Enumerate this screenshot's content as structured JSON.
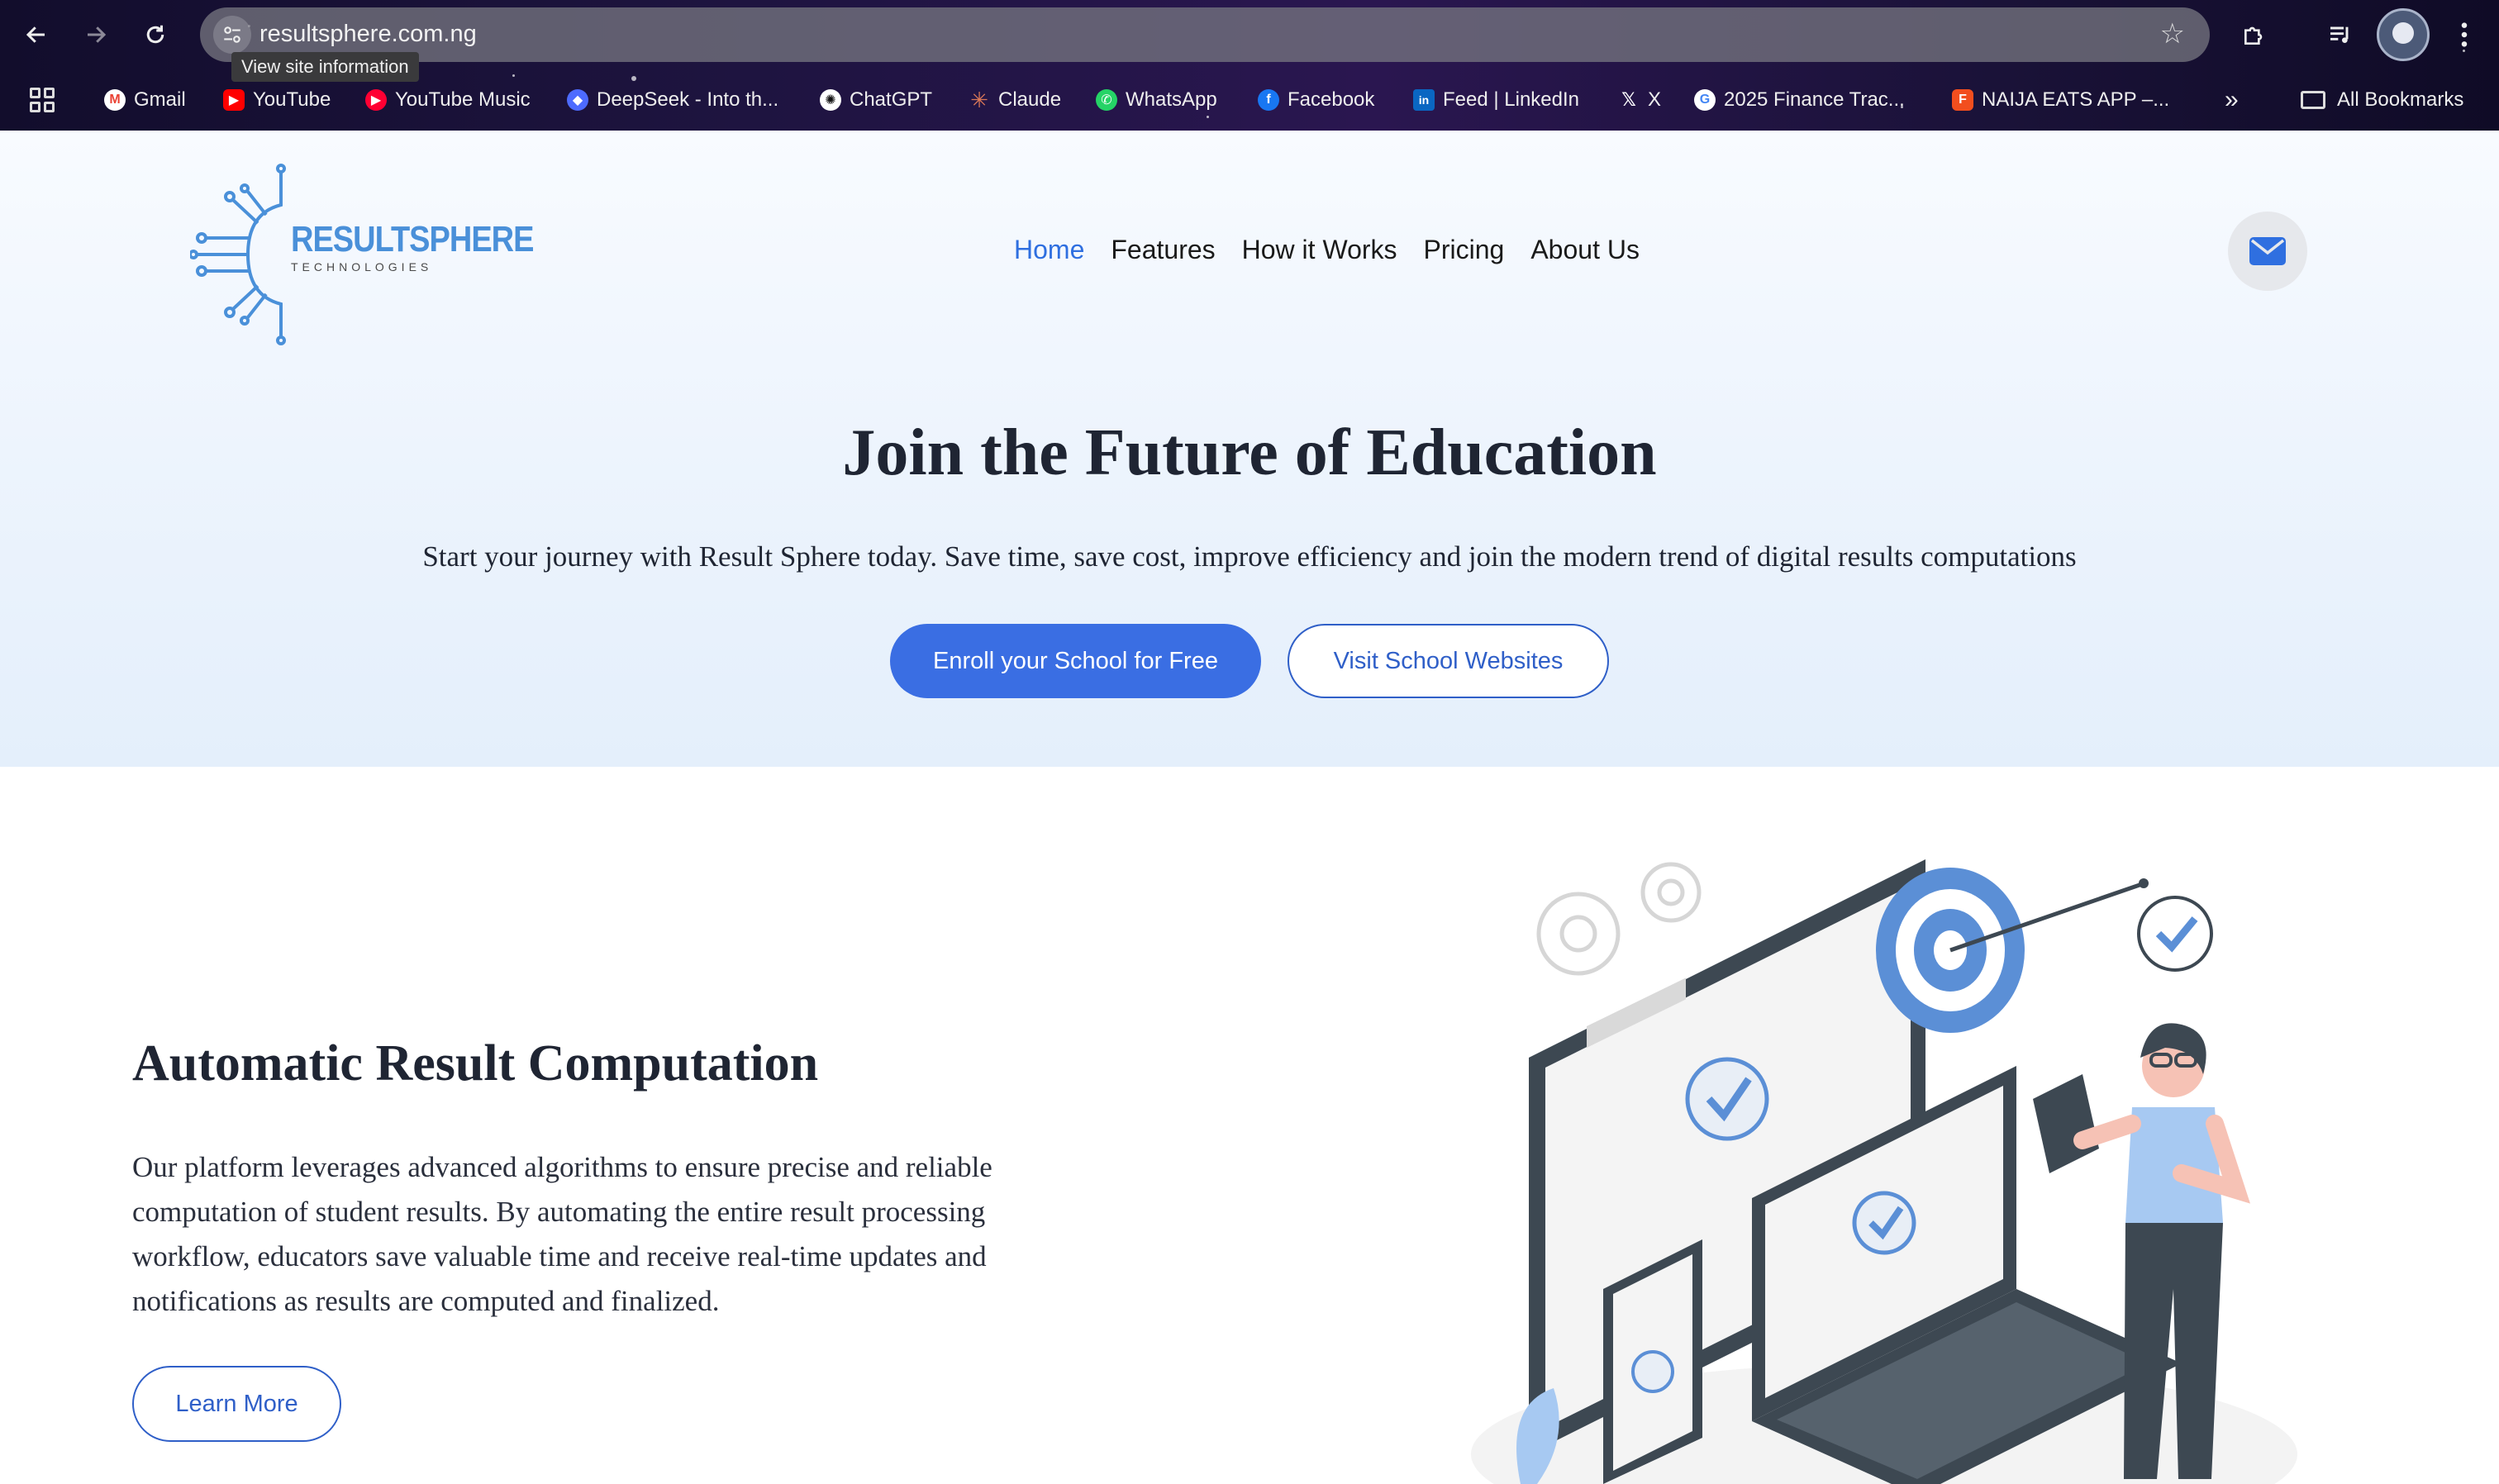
{
  "browser": {
    "url": "resultsphere.com.ng",
    "tooltip": "View site information",
    "bookmarks": [
      {
        "label": "Gmail",
        "icon": "gmail-icon",
        "color": "#ea4335"
      },
      {
        "label": "YouTube",
        "icon": "youtube-icon",
        "color": "#ff0000"
      },
      {
        "label": "YouTube Music",
        "icon": "youtube-music-icon",
        "color": "#ff0033"
      },
      {
        "label": "DeepSeek - Into th...",
        "icon": "deepseek-icon",
        "color": "#4d6bfe"
      },
      {
        "label": "ChatGPT",
        "icon": "chatgpt-icon",
        "color": "#ffffff"
      },
      {
        "label": "Claude",
        "icon": "claude-icon",
        "color": "#d97757"
      },
      {
        "label": "WhatsApp",
        "icon": "whatsapp-icon",
        "color": "#25d366"
      },
      {
        "label": "Facebook",
        "icon": "facebook-icon",
        "color": "#1877f2"
      },
      {
        "label": "Feed | LinkedIn",
        "icon": "linkedin-icon",
        "color": "#0a66c2"
      },
      {
        "label": "X",
        "icon": "x-icon",
        "color": "#ffffff"
      },
      {
        "label": "2025 Finance Trac...",
        "icon": "google-icon",
        "color": "#4285f4"
      },
      {
        "label": "NAIJA EATS APP –...",
        "icon": "figma-icon",
        "color": "#f24e1e"
      }
    ],
    "all_bookmarks": "All Bookmarks"
  },
  "site": {
    "logo_main": "RESULTSPHERE",
    "logo_sub": "TECHNOLOGIES",
    "nav": [
      "Home",
      "Features",
      "How it Works",
      "Pricing",
      "About Us"
    ],
    "active_nav": "Home",
    "accent": "#3a6ee3"
  },
  "hero": {
    "title": "Join the Future of Education",
    "subtitle": "Start your journey with Result Sphere today. Save time, save cost, improve efficiency and join the modern trend of digital results computations",
    "primary_cta": "Enroll your School for Free",
    "secondary_cta": "Visit School Websites"
  },
  "feature": {
    "title": "Automatic Result Computation",
    "body": "Our platform leverages advanced algorithms to ensure precise and reliable computation of student results. By automating the entire result processing workflow, educators save valuable time and receive real-time updates and notifications as results are computed and finalized.",
    "cta": "Learn More"
  }
}
